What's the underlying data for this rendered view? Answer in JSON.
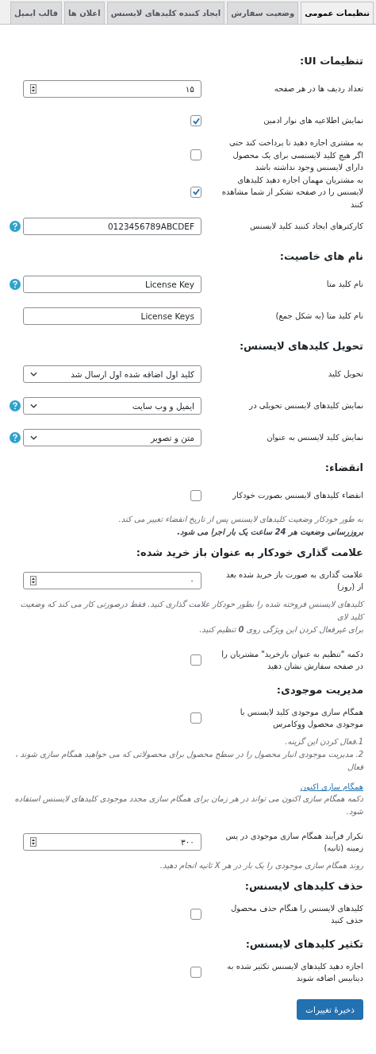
{
  "tabs": [
    {
      "label": "تنظیمات عمومی",
      "selected": true
    },
    {
      "label": "وضعیت سفارش",
      "selected": false
    },
    {
      "label": "ایجاد کننده کلیدهای لایسنس",
      "selected": false
    },
    {
      "label": "اعلان ها",
      "selected": false
    },
    {
      "label": "قالب ایمیل",
      "selected": false
    }
  ],
  "sections": [
    {
      "heading": "تنظیمات UI:",
      "rows": [
        {
          "kind": "number",
          "label": "تعداد ردیف ها در هر صفحه",
          "value": "۱۵",
          "help": false
        },
        {
          "kind": "checkbox",
          "label": "نمایش اطلاعیه های نوار ادمین",
          "checked": true
        },
        {
          "kind": "checkbox",
          "label": "به مشتری اجازه دهید تا پرداخت کند حتی اگر هیچ کلید لایسنسی برای یک محصول دارای لایسنس وجود نداشته باشد",
          "checked": false
        },
        {
          "kind": "checkbox",
          "label": "به مشتریان مهمان اجازه دهید کلیدهای لایسنس را در صفحه تشکر از شما مشاهده کنند",
          "checked": true
        },
        {
          "kind": "text",
          "label": "کارکترهای ایجاد کننید کلید لایسنس",
          "value": "0123456789ABCDEF",
          "help": true
        }
      ]
    },
    {
      "heading": "نام های خاصیت:",
      "rows": [
        {
          "kind": "text",
          "label": "نام کلید متا",
          "value": "License Key",
          "help": true
        },
        {
          "kind": "text",
          "label": "نام کلید متا (به شکل جمع)",
          "value": "License Keys",
          "help": false
        }
      ]
    },
    {
      "heading": "تحویل کلیدهای لایسنس:",
      "rows": [
        {
          "kind": "select",
          "label": "تحویل کلید",
          "value": "کلید اول اضافه شده اول ارسال شد",
          "help": false
        },
        {
          "kind": "select",
          "label": "نمایش کلیدهای لایسنس تحویلی در",
          "value": "ایمیل و وب سایت",
          "help": true
        },
        {
          "kind": "select",
          "label": "نمایش کلید لایسنس به عنوان",
          "value": "متن و تصویر",
          "help": true
        }
      ]
    },
    {
      "heading": "انقضاء:",
      "rows": [
        {
          "kind": "checkbox",
          "label": "انقضاء کلیدهای لایسنس بصورت خودکار",
          "checked": false
        },
        {
          "kind": "description",
          "lines": [
            {
              "text": "به طور خودکار وضعیت کلیدهای لایسنس پس از تاریخ انقضاء تغییر می کند.",
              "bold": false
            },
            {
              "text": "بروزرسانی وضعیت هر 24 ساعت یک بار اجرا می شود.",
              "bold": true
            }
          ]
        }
      ]
    },
    {
      "heading": "علامت گذاری خودکار به عنوان باز خرید شده:",
      "rows": [
        {
          "kind": "number",
          "label": "علامت گذاری به صورت باز خرید شده بعد از (روز)",
          "value": "۰",
          "help": false
        },
        {
          "kind": "description",
          "lines": [
            {
              "text": "کلیدهای لایسنس فروخته شده را بطور خودکار علامت گذاری کنید. فقط درصورتی کار می کند که وضعیت کلید لای",
              "bold": false
            },
            {
              "text": "برای غیرفعال کردن این ویژگی روی **0** تنظیم کنید.",
              "bold": false
            }
          ]
        },
        {
          "kind": "checkbox",
          "label": "دکمه \"تنظیم به عنوان بازخرید\" مشتریان را در صفحه سفارش نشان دهید",
          "checked": false
        }
      ]
    },
    {
      "heading": "مدیریت موجودی:",
      "rows": [
        {
          "kind": "checkbox",
          "label": "همگام سازی موجودی کلید لایسنس با موجودی محصول ووکامرس",
          "checked": false
        },
        {
          "kind": "description",
          "lines": [
            {
              "text": "1.فعال کردن این گزینه.",
              "bold": false
            },
            {
              "text": "2. مدیریت موجودی انبار محصول را در سطح محصول برای محصولاتی که می خواهید همگام سازی شوند ، فعال",
              "bold": false
            }
          ]
        },
        {
          "kind": "link",
          "text": "همگام سازی اکنون"
        },
        {
          "kind": "description",
          "lines": [
            {
              "text": "دکمه همگام سازی اکنون می تواند در هر زمان برای همگام سازی مجدد موجودی کلیدهای لایسنس استفاده شود.",
              "bold": false
            }
          ]
        },
        {
          "kind": "number",
          "label": "تکرار فرآیند همگام سازی موجودی در پس زمینه (ثانیه)",
          "value": "۳۰۰",
          "help": false
        },
        {
          "kind": "description",
          "lines": [
            {
              "text": "روند همگام سازی موجودی را یک بار در هر X ثانیه انجام دهید.",
              "bold": false
            }
          ]
        }
      ]
    },
    {
      "heading": "حذف کلیدهای لایسنس:",
      "rows": [
        {
          "kind": "checkbox",
          "label": "کلیدهای لایسنس را هنگام حذف محصول حذف کنید",
          "checked": false
        }
      ]
    },
    {
      "heading": "تکثیر کلیدهای لایسنس:",
      "rows": [
        {
          "kind": "checkbox",
          "label": "اجازه دهید کلیدهای لایسنس تکثیر شده به دیتابیس اضافه شوند",
          "checked": false
        }
      ]
    }
  ],
  "save_button": "ذخیرهٔ تغییرات"
}
